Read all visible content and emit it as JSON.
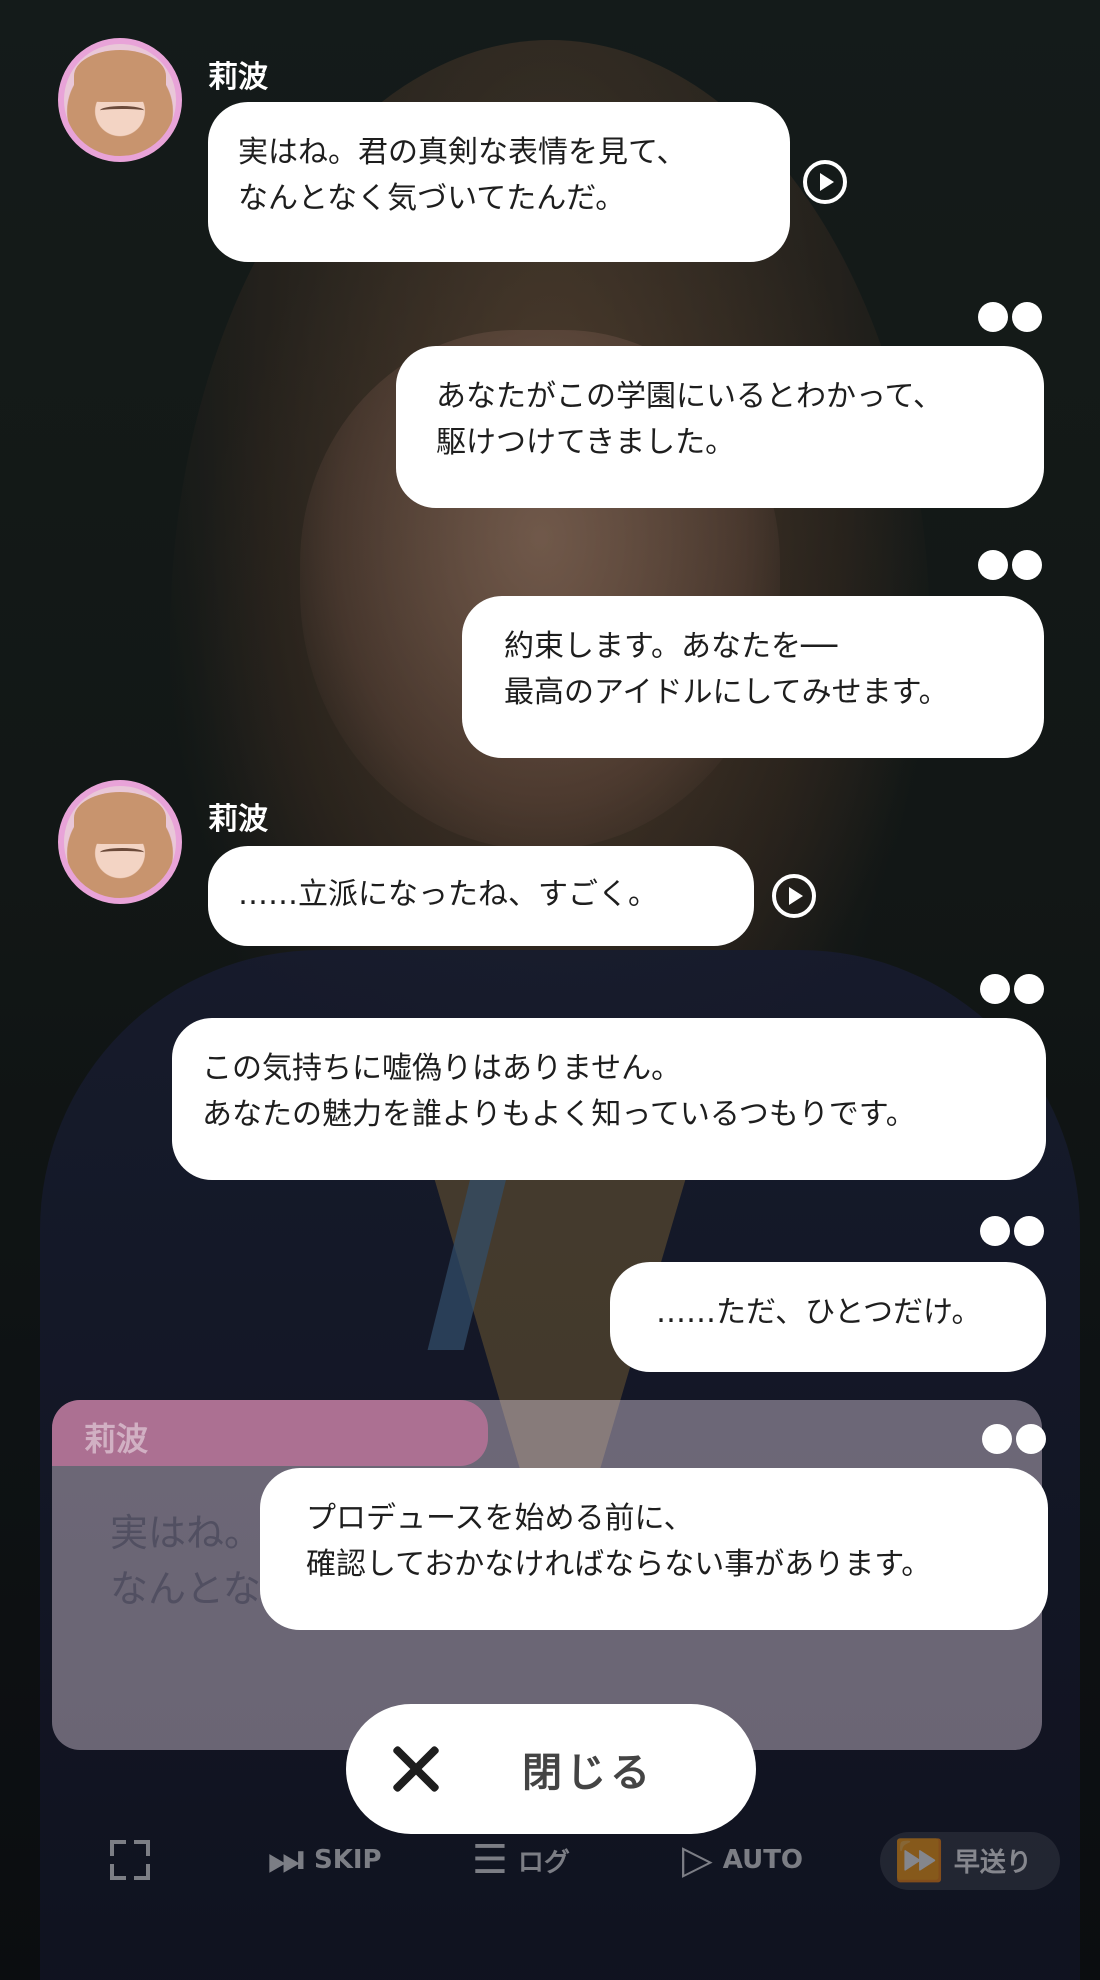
{
  "speaker": {
    "name": "莉波"
  },
  "messages": [
    {
      "from": "speaker",
      "text": "実はね。君の真剣な表情を見て、\nなんとなく気づいてたんだ。"
    },
    {
      "from": "player",
      "text": "あなたがこの学園にいるとわかって、\n駆けつけてきました。"
    },
    {
      "from": "player",
      "text": "約束します。あなたを──\n最高のアイドルにしてみせます。"
    },
    {
      "from": "speaker",
      "text": "……立派になったね、すごく。"
    },
    {
      "from": "player",
      "text": "この気持ちに嘘偽りはありません。\nあなたの魅力を誰よりもよく知っているつもりです。"
    },
    {
      "from": "player",
      "text": "……ただ、ひとつだけ。"
    },
    {
      "from": "player",
      "text": "プロデュースを始める前に、\n確認しておかなければならない事があります。"
    }
  ],
  "dialogue_panel": {
    "name": "莉波",
    "text": "実はね。\nなんとな"
  },
  "close_button": {
    "label": "閉じる"
  },
  "toolbar": {
    "skip": "SKIP",
    "log": "ログ",
    "auto": "AUTO",
    "fast_forward": "早送り"
  },
  "colors": {
    "avatar_border": "#e8a3d8",
    "bubble": "#ffffff",
    "name_tab": "#e178aa"
  }
}
